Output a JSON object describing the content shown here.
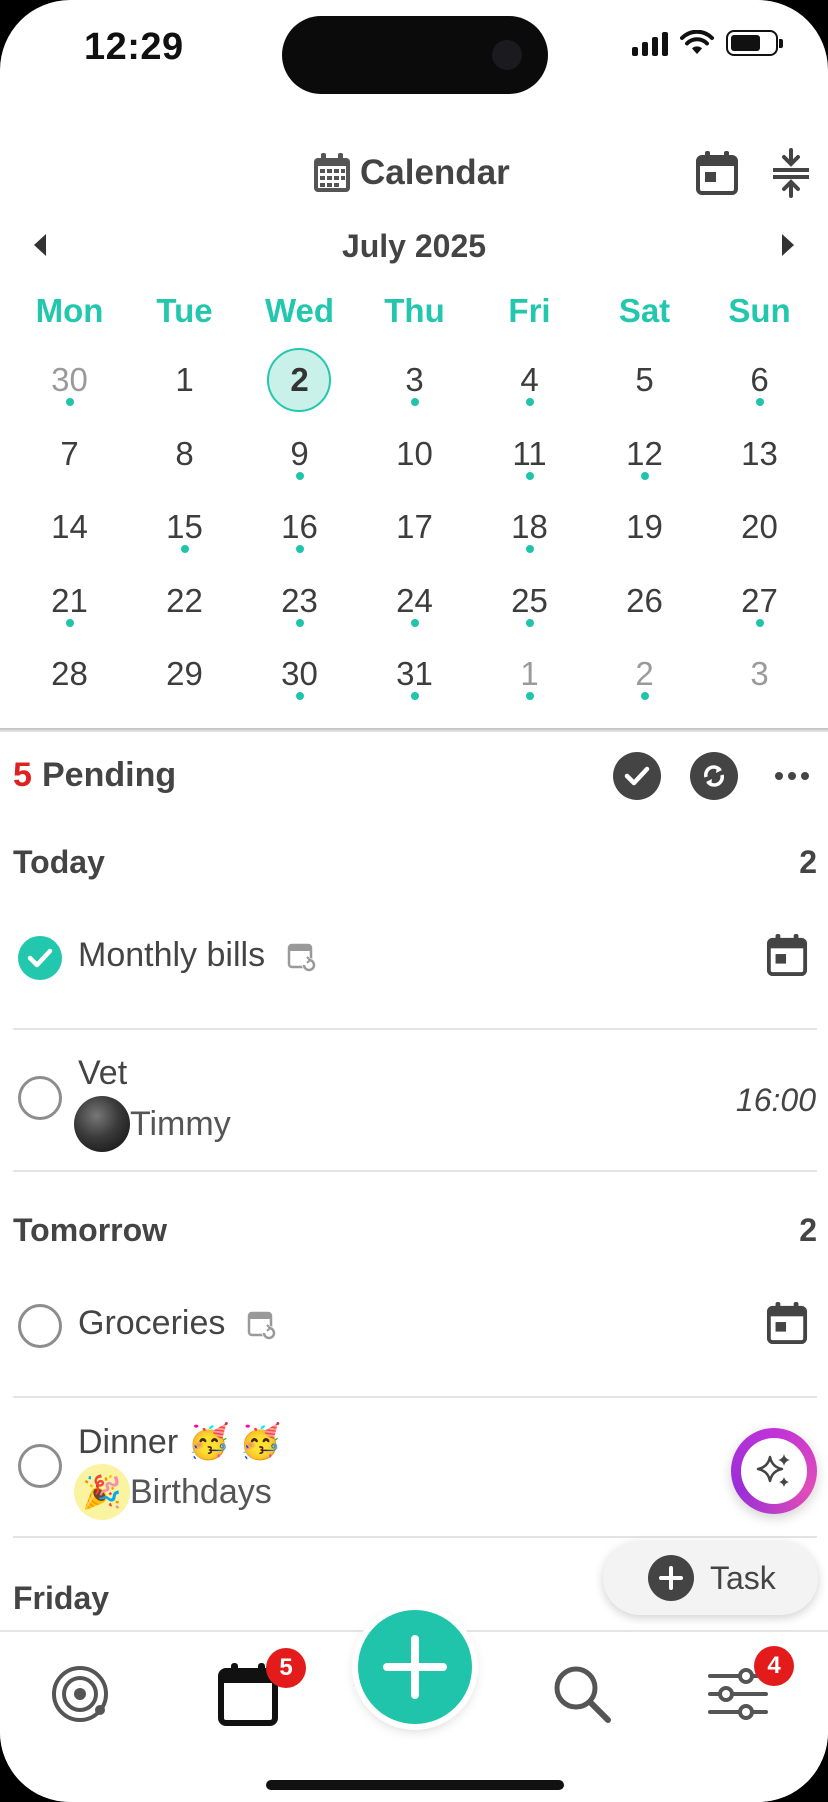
{
  "status": {
    "time": "12:29"
  },
  "header": {
    "title": "Calendar",
    "icons": [
      "calendar-grid-icon",
      "calendar-today-icon",
      "collapse-icon"
    ]
  },
  "month": {
    "label": "July 2025"
  },
  "weekdays": [
    "Mon",
    "Tue",
    "Wed",
    "Thu",
    "Fri",
    "Sat",
    "Sun"
  ],
  "weeks": [
    [
      {
        "d": "30",
        "o": true,
        "dot": true
      },
      {
        "d": "1"
      },
      {
        "d": "2",
        "today": true
      },
      {
        "d": "3",
        "dot": true
      },
      {
        "d": "4",
        "dot": true
      },
      {
        "d": "5"
      },
      {
        "d": "6",
        "dot": true
      }
    ],
    [
      {
        "d": "7"
      },
      {
        "d": "8"
      },
      {
        "d": "9",
        "dot": true
      },
      {
        "d": "10"
      },
      {
        "d": "11",
        "dot": true
      },
      {
        "d": "12",
        "dot": true
      },
      {
        "d": "13"
      }
    ],
    [
      {
        "d": "14"
      },
      {
        "d": "15",
        "dot": true
      },
      {
        "d": "16",
        "dot": true
      },
      {
        "d": "17"
      },
      {
        "d": "18",
        "dot": true
      },
      {
        "d": "19"
      },
      {
        "d": "20"
      }
    ],
    [
      {
        "d": "21",
        "dot": true
      },
      {
        "d": "22"
      },
      {
        "d": "23",
        "dot": true
      },
      {
        "d": "24",
        "dot": true
      },
      {
        "d": "25",
        "dot": true
      },
      {
        "d": "26"
      },
      {
        "d": "27",
        "dot": true
      }
    ],
    [
      {
        "d": "28"
      },
      {
        "d": "29"
      },
      {
        "d": "30",
        "dot": true
      },
      {
        "d": "31",
        "dot": true
      },
      {
        "d": "1",
        "o": true,
        "dot": true
      },
      {
        "d": "2",
        "o": true,
        "dot": true
      },
      {
        "d": "3",
        "o": true
      }
    ]
  ],
  "pending": {
    "count": "5",
    "label": "Pending"
  },
  "sections": {
    "today": {
      "title": "Today",
      "count": "2"
    },
    "tomorrow": {
      "title": "Tomorrow",
      "count": "2"
    },
    "friday": {
      "title": "Friday"
    }
  },
  "tasks": {
    "monthly_bills": {
      "title": "Monthly bills",
      "done": true
    },
    "vet": {
      "title": "Vet",
      "list": "Timmy",
      "time": "16:00"
    },
    "groceries": {
      "title": "Groceries"
    },
    "dinner": {
      "title": "Dinner 🥳 🥳",
      "list": "Birthdays"
    }
  },
  "fab": {
    "task_label": "Task"
  },
  "nav": {
    "calendar_badge": "5",
    "settings_badge": "4"
  },
  "colors": {
    "accent": "#1fc4aa",
    "badge": "#e31b1b",
    "text": "#444444"
  }
}
